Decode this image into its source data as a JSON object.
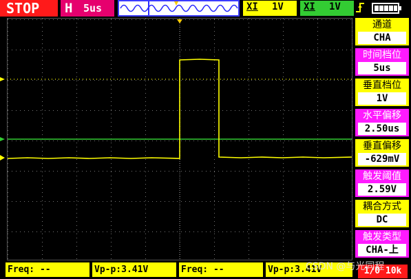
{
  "top_bar": {
    "run_state": "STOP",
    "h_label": "H",
    "time_base": "5us",
    "ch1": {
      "coupling": "XI",
      "volts": "1V",
      "color": "#ffff00"
    },
    "ch2": {
      "coupling": "XI",
      "volts": "1V",
      "color": "#33cc33"
    }
  },
  "menu": [
    {
      "label": "通道",
      "value": "CHA",
      "style": "yellow"
    },
    {
      "label": "时间档位",
      "value": "5us",
      "style": "magenta"
    },
    {
      "label": "垂直档位",
      "value": "1V",
      "style": "yellow"
    },
    {
      "label": "水平偏移",
      "value": "2.50us",
      "style": "magenta"
    },
    {
      "label": "垂直偏移",
      "value": "-629mV",
      "style": "yellow"
    },
    {
      "label": "触发阈值",
      "value": "2.59V",
      "style": "magenta"
    },
    {
      "label": "耦合方式",
      "value": "DC",
      "style": "yellow"
    },
    {
      "label": "触发类型",
      "value": "CHA-上",
      "style": "magenta"
    }
  ],
  "measurements": [
    {
      "text": "Freq: --"
    },
    {
      "text": "Vp-p:3.41V"
    },
    {
      "text": "Freq: --"
    },
    {
      "text": "Vp-p:3.41V"
    }
  ],
  "watermark": "CSDN @与光同程",
  "corner_badge": "1/0 10k",
  "colors": {
    "trace_ch1": "#ffff00",
    "trace_ch2": "#33cc33",
    "trigger_marker": "#ffff00"
  }
}
